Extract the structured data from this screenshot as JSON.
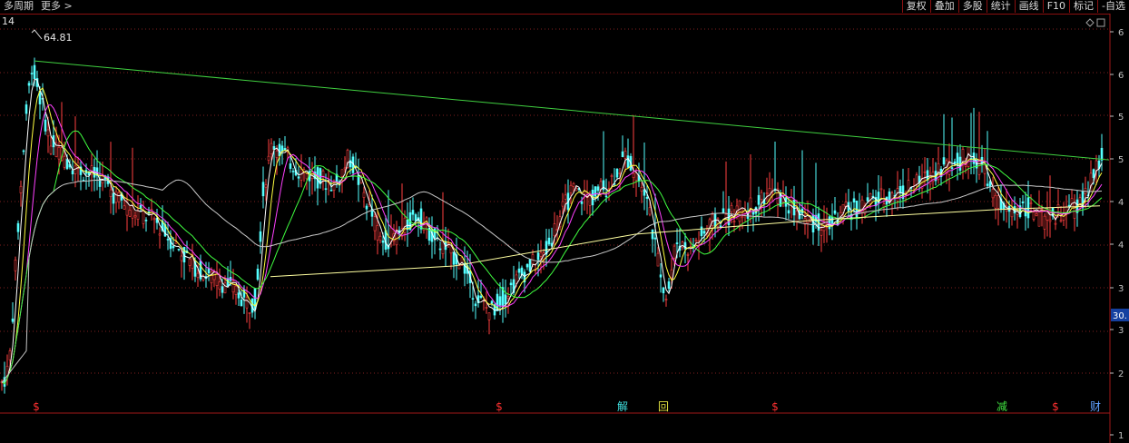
{
  "toolbar": {
    "period_label": "多周期",
    "more_label": "更多 >",
    "buttons": [
      "复权",
      "叠加",
      "多股",
      "统计",
      "画线",
      "F10",
      "标记",
      "-自选"
    ]
  },
  "chart_data": {
    "type": "candlestick",
    "left_price_label": "14",
    "peak_label": "64.81",
    "price_tag": "30.",
    "ylim": [
      15,
      68
    ],
    "right_axis_ticks": [
      "6",
      "6",
      "5",
      "5",
      "4",
      "4",
      "3",
      "3",
      "2",
      "1"
    ],
    "event_markers": [
      {
        "text": "$",
        "color": "#ff3030"
      },
      {
        "text": "$",
        "color": "#ff3030"
      },
      {
        "text": "解",
        "color": "#40e0e0"
      },
      {
        "text": "回",
        "color": "#e0e040"
      },
      {
        "text": "$",
        "color": "#ff3030"
      },
      {
        "text": "减",
        "color": "#40e040"
      },
      {
        "text": "$",
        "color": "#ff3030"
      },
      {
        "text": "财",
        "color": "#60a0ff"
      }
    ],
    "colors": {
      "up": "#ff4040",
      "down": "#54ffff",
      "ma_white": "#ffffff",
      "ma_yellow": "#ffff40",
      "ma_magenta": "#ff40ff",
      "ma_green": "#40ff40",
      "ma_long_grey": "#c8c8c8",
      "ma_long_yellow": "#ffffa0",
      "trendline": "#40d040",
      "grid": "#802020"
    }
  }
}
